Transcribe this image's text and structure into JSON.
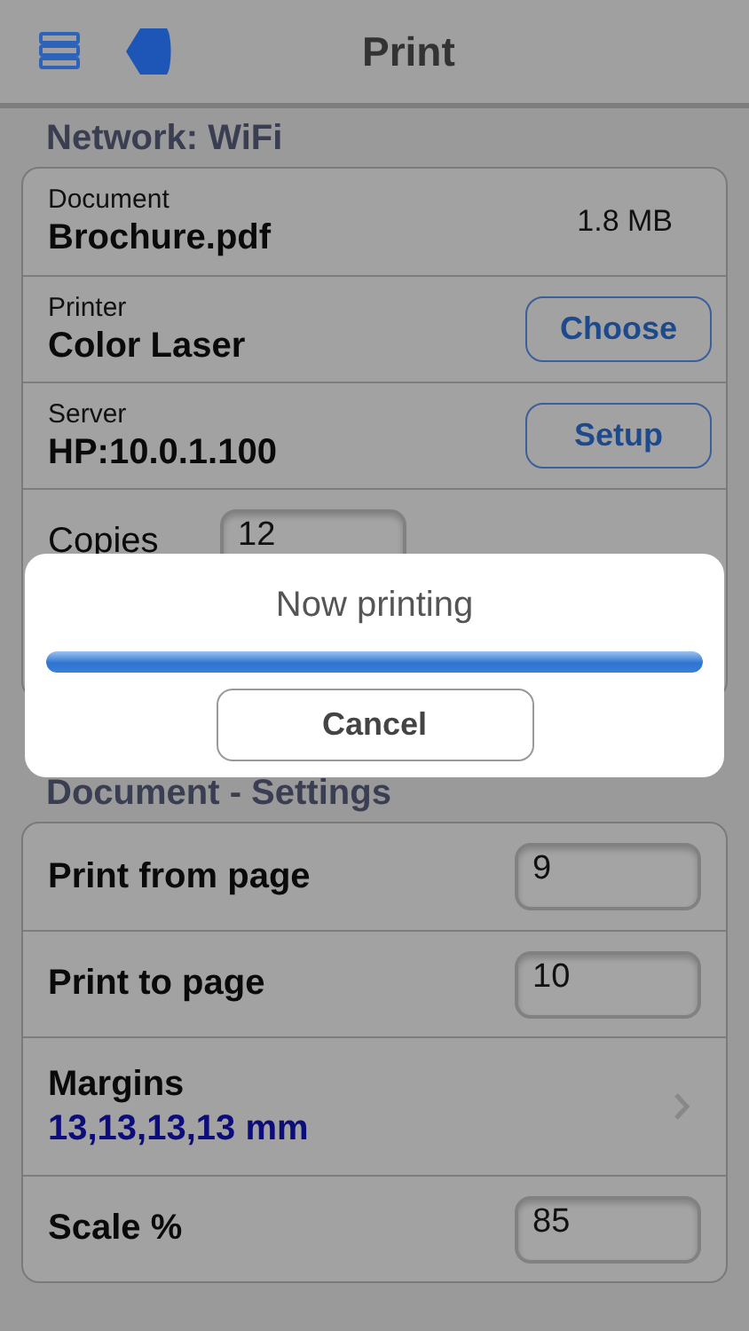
{
  "nav": {
    "title": "Print"
  },
  "network": {
    "header": "Network: WiFi",
    "rows": [
      {
        "kind": "info",
        "label": "Document",
        "value": "Brochure.pdf",
        "size": "1.8 MB"
      },
      {
        "kind": "button",
        "label": "Printer",
        "value": "Color Laser",
        "button": "Choose"
      },
      {
        "kind": "button",
        "label": "Server",
        "value": "HP:10.0.1.100",
        "button": "Setup"
      },
      {
        "kind": "input",
        "label": "Copies",
        "value": "12"
      }
    ]
  },
  "settings": {
    "header": "Document - Settings",
    "rows": [
      {
        "kind": "input",
        "label": "Print from page",
        "value": "9"
      },
      {
        "kind": "input",
        "label": "Print to page",
        "value": "10"
      },
      {
        "kind": "link",
        "label": "Margins",
        "value": "13,13,13,13 mm"
      },
      {
        "kind": "input",
        "label": "Scale %",
        "value": "85"
      }
    ]
  },
  "dialog": {
    "title": "Now printing",
    "level": 1,
    "button": "Cancel"
  }
}
